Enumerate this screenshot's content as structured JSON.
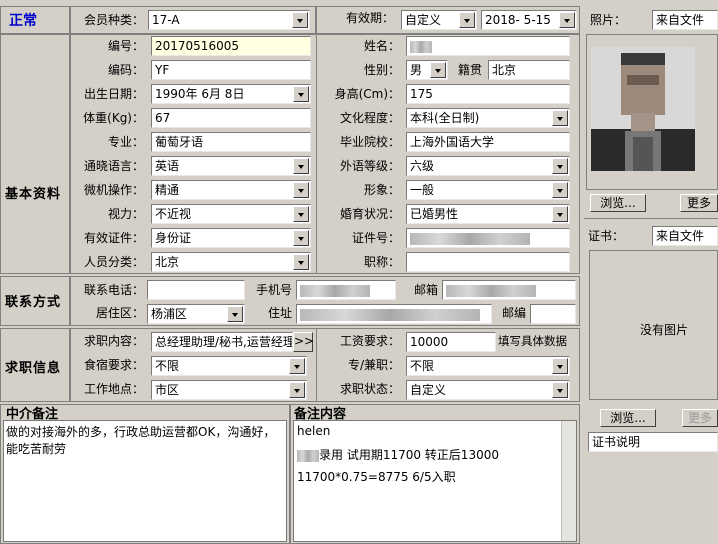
{
  "status": "正常",
  "header": {
    "member_type_label": "会员种类：",
    "member_type_value": "17-A",
    "validity_label": "有效期：",
    "validity_value": "自定义",
    "validity_date": "2018- 5-15"
  },
  "sections": {
    "basic": "基本资料",
    "contact": "联系方式",
    "job": "求职信息"
  },
  "basic": {
    "number_label": "编号：",
    "number_value": "20170516005",
    "name_label": "姓名：",
    "code_label": "编码：",
    "code_value": "YF",
    "gender_label": "性别：",
    "gender_value": "男",
    "origin_label": "籍贯",
    "origin_value": "北京",
    "birth_label": "出生日期：",
    "birth_value": "1990年 6月 8日",
    "height_label": "身高(Cm)：",
    "height_value": "175",
    "weight_label": "体重(Kg)：",
    "weight_value": "67",
    "education_label": "文化程度：",
    "education_value": "本科(全日制)",
    "major_label": "专业：",
    "major_value": "葡萄牙语",
    "school_label": "毕业院校：",
    "school_value": "上海外国语大学",
    "language_label": "通晓语言：",
    "language_value": "英语",
    "foreign_level_label": "外语等级：",
    "foreign_level_value": "六级",
    "computer_label": "微机操作：",
    "computer_value": "精通",
    "appearance_label": "形象：",
    "appearance_value": "一般",
    "vision_label": "视力：",
    "vision_value": "不近视",
    "marital_label": "婚育状况：",
    "marital_value": "已婚男性",
    "id_type_label": "有效证件：",
    "id_type_value": "身份证",
    "id_no_label": "证件号：",
    "category_label": "人员分类：",
    "category_value": "北京",
    "title_label": "职称："
  },
  "contact": {
    "phone_label": "联系电话：",
    "mobile_label": "手机号",
    "email_label": "邮箱",
    "district_label": "居住区：",
    "district_value": "杨浦区",
    "address_label": "住址",
    "postcode_label": "邮编"
  },
  "job": {
    "content_label": "求职内容：",
    "content_value": "总经理助理/秘书,运营经理",
    "more_btn": ">>",
    "salary_label": "工资要求：",
    "salary_value": "10000",
    "salary_hint": "填写具体数据",
    "meal_label": "食宿要求：",
    "meal_value": "不限",
    "fulltime_label": "专/兼职：",
    "fulltime_value": "不限",
    "location_label": "工作地点：",
    "location_value": "市区",
    "state_label": "求职状态：",
    "state_value": "自定义"
  },
  "notes": {
    "agent_title": "中介备注",
    "agent_text": "做的对接海外的多，行政总助运营都OK，沟通好，能吃苦耐劳",
    "remark_title": "备注内容",
    "remark_line1": "helen",
    "remark_line2": "录用   试用期11700  转正后13000",
    "remark_line3": "11700*0.75=8775  6/5入职"
  },
  "photo": {
    "label": "照片：",
    "source": "来自文件",
    "browse": "浏览...",
    "more": "更多"
  },
  "cert": {
    "label": "证书：",
    "source": "来自文件",
    "empty": "没有图片",
    "browse": "浏览...",
    "more": "更多",
    "desc": "证书说明"
  }
}
